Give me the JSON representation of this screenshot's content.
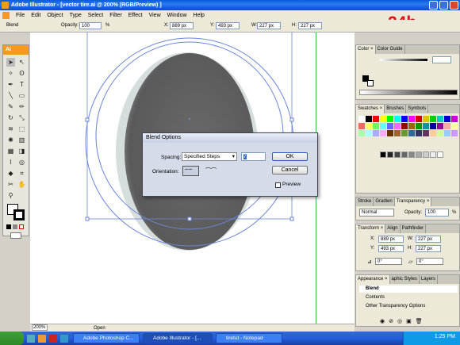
{
  "window": {
    "title": "Adobe Illustrator - [vector tire.ai @ 200% (RGB/Preview) ]"
  },
  "step_label": "24b",
  "menu": [
    "File",
    "Edit",
    "Object",
    "Type",
    "Select",
    "Filter",
    "Effect",
    "View",
    "Window",
    "Help"
  ],
  "control": {
    "mode": "Blend",
    "opacity_label": "Opacity:",
    "opacity_value": "100",
    "opacity_unit": "%",
    "x_label": "X:",
    "x_value": "889 px",
    "y_label": "Y:",
    "y_value": "493 px",
    "w_label": "W:",
    "w_value": "227 px",
    "h_label": "H:",
    "h_value": "227 px"
  },
  "toolbox": {
    "logo": "Ai",
    "tool_glyphs": [
      "T",
      "T",
      "✎",
      "\\",
      "▭",
      "✂",
      "◯",
      "⌂",
      "✚",
      "⊙",
      "▦",
      "◈",
      "✋",
      "🔍"
    ]
  },
  "dialog": {
    "title": "Blend Options",
    "spacing_label": "Spacing:",
    "spacing_value": "Specified Steps",
    "steps_value": "7",
    "orientation_label": "Orientation:",
    "ok_label": "OK",
    "cancel_label": "Cancel",
    "preview_label": "Preview"
  },
  "panels": {
    "color": {
      "tabs": [
        "Color ×",
        "Color Guide"
      ]
    },
    "swatches": {
      "tabs": [
        "Swatches ×",
        "Brushes",
        "Symbols"
      ]
    },
    "stroke": {
      "tabs": [
        "Stroke",
        "Gradien",
        "Transparency ×"
      ],
      "mode": "Normal",
      "opacity_label": "Opacity:",
      "opacity_value": "100",
      "opacity_unit": "%"
    },
    "transform": {
      "tabs": [
        "Transform ×",
        "Align",
        "Pathfinder"
      ],
      "x_label": "X:",
      "x_value": "889 px",
      "y_label": "Y:",
      "y_value": "493 px",
      "w_label": "W:",
      "w_value": "227 px",
      "h_label": "H:",
      "h_value": "227 px",
      "rot_value": "0°",
      "shear_value": "0°"
    },
    "appearance": {
      "tabs": [
        "Appearance ×",
        "aphic Styles",
        "Layers"
      ],
      "items": [
        "Blend",
        "Contents",
        "Other Transparency Options"
      ]
    }
  },
  "status": {
    "zoom": "200%",
    "state": "Open"
  },
  "taskbar": {
    "tasks": [
      "Adobe Photoshop C...",
      "Adobe Illustrator - [...",
      "tiretut - Notepad"
    ],
    "clock": "1:25 PM"
  },
  "colors": {
    "accent": "#f59a1b",
    "step_label": "#e01010",
    "titlebar": "#0a5bd8"
  }
}
